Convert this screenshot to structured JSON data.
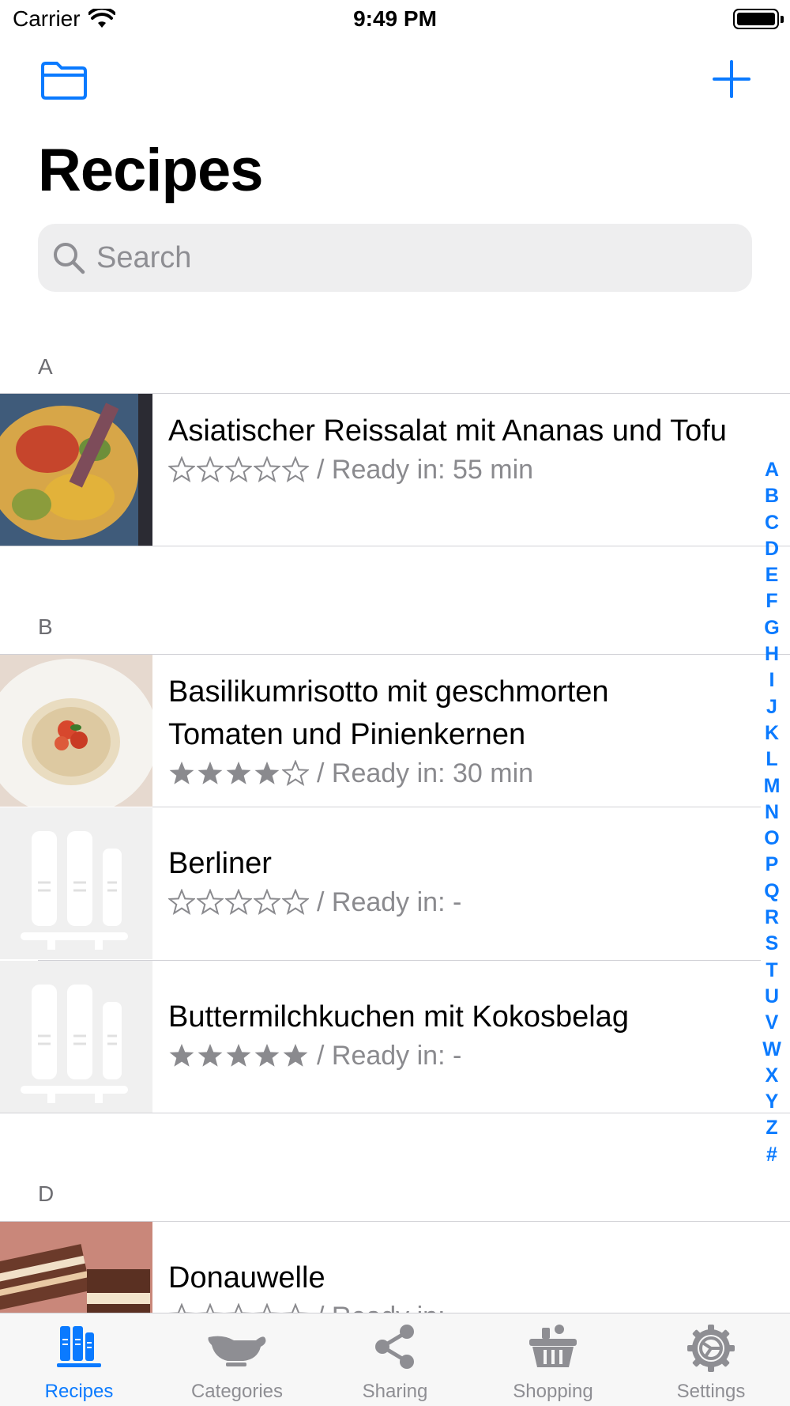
{
  "status_bar": {
    "carrier": "Carrier",
    "time": "9:49 PM"
  },
  "nav": {
    "title": "Recipes"
  },
  "search": {
    "placeholder": "Search"
  },
  "sections": [
    {
      "letter": "A",
      "rows": [
        {
          "title": "Asiatischer Reissalat mit Ananas und Tofu",
          "rating": 0,
          "meta": "/ Ready in: 55 min",
          "thumb": "salad-photo"
        }
      ]
    },
    {
      "letter": "B",
      "rows": [
        {
          "title": "Basilikumrisotto mit geschmorten Tomaten und Pinienkernen",
          "rating": 4,
          "meta": "/ Ready in: 30 min",
          "thumb": "risotto-photo"
        },
        {
          "title": "Berliner",
          "rating": 0,
          "meta": "/ Ready in: -",
          "thumb": "placeholder-books-icon"
        },
        {
          "title": "Buttermilchkuchen mit Kokosbelag",
          "rating": 5,
          "meta": "/ Ready in: -",
          "thumb": "placeholder-books-icon"
        }
      ]
    },
    {
      "letter": "D",
      "rows": [
        {
          "title": "Donauwelle",
          "rating": 0,
          "meta": "/ Ready in: -",
          "thumb": "cake-photo"
        }
      ]
    }
  ],
  "index": [
    "A",
    "B",
    "C",
    "D",
    "E",
    "F",
    "G",
    "H",
    "I",
    "J",
    "K",
    "L",
    "M",
    "N",
    "O",
    "P",
    "Q",
    "R",
    "S",
    "T",
    "U",
    "V",
    "W",
    "X",
    "Y",
    "Z",
    "#"
  ],
  "tabs": [
    {
      "label": "Recipes",
      "icon": "books-icon",
      "active": true
    },
    {
      "label": "Categories",
      "icon": "gravy-boat-icon",
      "active": false
    },
    {
      "label": "Sharing",
      "icon": "share-icon",
      "active": false
    },
    {
      "label": "Shopping",
      "icon": "basket-icon",
      "active": false
    },
    {
      "label": "Settings",
      "icon": "gear-icon",
      "active": false
    }
  ],
  "colors": {
    "tint": "#0a7aff",
    "secondary_text": "#8a8a8e",
    "tab_inactive": "#8e8e93",
    "separator": "#d1d1d6"
  }
}
